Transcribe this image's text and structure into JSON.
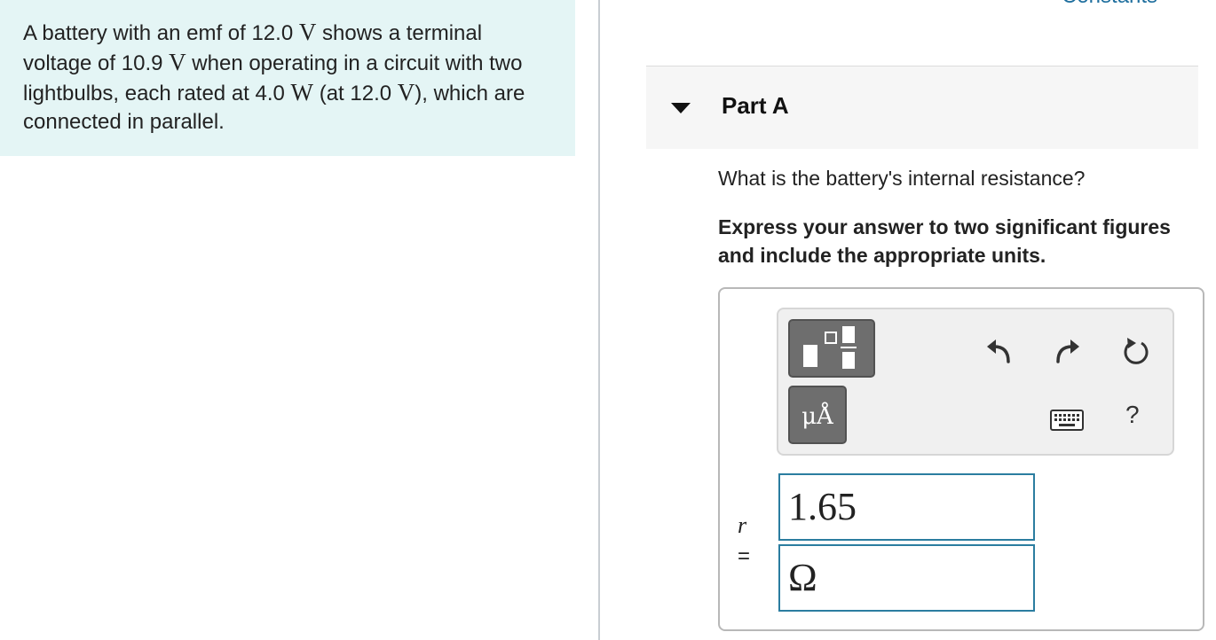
{
  "header": {
    "constants_link": "Constants"
  },
  "problem": {
    "segments": [
      "A battery with an emf of 12.0 ",
      "V",
      " shows a terminal voltage of 10.9 ",
      "V",
      " when operating in a circuit with two lightbulbs, each rated at 4.0 ",
      "W",
      " (at 12.0 ",
      "V",
      "), which are connected in parallel."
    ]
  },
  "part": {
    "title": "Part A",
    "question": "What is the battery's internal resistance?",
    "instruction": "Express your answer to two significant figures and include the appropriate units."
  },
  "toolbar": {
    "templates_icon": "fraction-template-icon",
    "units_label": "μÅ",
    "undo_icon": "undo-icon",
    "redo_icon": "redo-icon",
    "reset_icon": "reset-icon",
    "keyboard_icon": "keyboard-icon",
    "help_label": "?"
  },
  "answer": {
    "variable": "r",
    "equals": "=",
    "value": "1.65",
    "unit": "Ω"
  },
  "colors": {
    "problem_background": "#e4f5f5",
    "link": "#1f6f9e",
    "input_border": "#2b7da0"
  }
}
